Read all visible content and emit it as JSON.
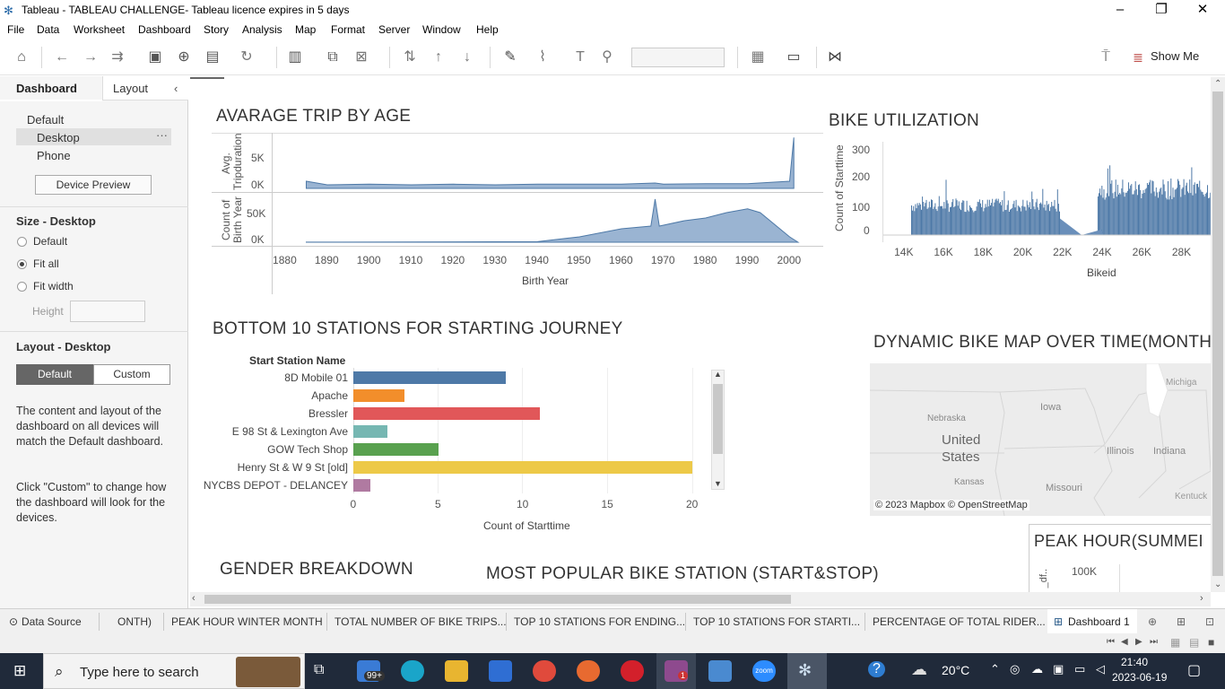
{
  "window": {
    "title": "Tableau - TABLEAU CHALLENGE- Tableau licence expires in 5 days"
  },
  "menu": [
    "File",
    "Data",
    "Worksheet",
    "Dashboard",
    "Story",
    "Analysis",
    "Map",
    "Format",
    "Server",
    "Window",
    "Help"
  ],
  "toolbar": {
    "show_me": "Show Me"
  },
  "left_pane": {
    "tabs": [
      "Dashboard",
      "Layout"
    ],
    "devices": [
      "Default",
      "Desktop",
      "Phone"
    ],
    "device_preview": "Device Preview",
    "size_header": "Size - Desktop",
    "size_options": [
      "Default",
      "Fit all",
      "Fit width"
    ],
    "size_selected": "Fit all",
    "height_label": "Height",
    "layout_header": "Layout - Desktop",
    "layout_buttons": [
      "Default",
      "Custom"
    ],
    "desc1": "The content and layout of the dashboard on all devices will match the Default dashboard.",
    "desc2": "Click \"Custom\" to change how the dashboard will look for the devices."
  },
  "dashboard": {
    "trip_by_age": {
      "title": "AVARAGE TRIP BY AGE",
      "y1_label": "Avg. Tripduration",
      "y1_ticks": [
        "5K",
        "0K"
      ],
      "y2_label": "Count of Birth Year",
      "y2_ticks": [
        "50K",
        "0K"
      ],
      "x_ticks": [
        "1880",
        "1890",
        "1900",
        "1910",
        "1920",
        "1930",
        "1940",
        "1950",
        "1960",
        "1970",
        "1980",
        "1990",
        "2000"
      ],
      "x_label": "Birth Year"
    },
    "bike_utilization": {
      "title": "BIKE UTILIZATION",
      "y_label": "Count of Starttime",
      "y_ticks": [
        "300",
        "200",
        "100",
        "0"
      ],
      "x_ticks": [
        "14K",
        "16K",
        "18K",
        "20K",
        "22K",
        "24K",
        "26K",
        "28K"
      ],
      "x_label": "Bikeid"
    },
    "bottom10": {
      "title": "BOTTOM 10 STATIONS FOR STARTING JOURNEY",
      "header": "Start Station Name",
      "x_ticks": [
        "0",
        "5",
        "10",
        "15",
        "20"
      ],
      "x_label": "Count of Starttime"
    },
    "map": {
      "title": "DYNAMIC BIKE MAP OVER TIME(MONTH",
      "labels": [
        "Michiga",
        "Nebraska",
        "Iowa",
        "United",
        "States",
        "Illinois",
        "Indiana",
        "Kansas",
        "Missouri",
        "Kentuck"
      ],
      "credit": "© 2023 Mapbox © OpenStreetMap"
    },
    "peak_hour": {
      "title": "PEAK HOUR(SUMMEI",
      "tick": "100K",
      "y_label": "_df.."
    },
    "gender": {
      "title": "GENDER BREAKDOWN"
    },
    "popular": {
      "title": "MOST POPULAR BIKE STATION (START&STOP)"
    }
  },
  "chart_data": [
    {
      "type": "area",
      "title": "AVARAGE TRIP BY AGE",
      "xlabel": "Birth Year",
      "series": [
        {
          "name": "Avg. Tripduration",
          "x": [
            1885,
            1890,
            1900,
            1910,
            1920,
            1930,
            1940,
            1950,
            1960,
            1968,
            1970,
            1980,
            1990,
            2000,
            2001
          ],
          "values": [
            1200,
            600,
            700,
            600,
            700,
            600,
            700,
            700,
            700,
            900,
            700,
            800,
            800,
            1200,
            8500
          ]
        },
        {
          "name": "Count of Birth Year",
          "x": [
            1885,
            1940,
            1950,
            1960,
            1967,
            1968,
            1969,
            1975,
            1980,
            1985,
            1990,
            1993,
            2000,
            2002
          ],
          "values": [
            100,
            1000,
            10000,
            25000,
            30000,
            80000,
            30000,
            40000,
            45000,
            55000,
            62000,
            55000,
            10000,
            0
          ]
        }
      ]
    },
    {
      "type": "bar",
      "title": "BIKE UTILIZATION",
      "xlabel": "Bikeid",
      "ylabel": "Count of Starttime",
      "xlim": [
        13000,
        29500
      ],
      "ylim": [
        0,
        330
      ],
      "segments": [
        {
          "from": 14400,
          "to": 21900,
          "typical": 110,
          "max": 190
        },
        {
          "from": 23800,
          "to": 29500,
          "typical": 170,
          "max": 240
        }
      ],
      "fill_between": [
        [
          21900,
          23000
        ],
        [
          23000,
          24000
        ]
      ]
    },
    {
      "type": "bar",
      "title": "BOTTOM 10 STATIONS FOR STARTING JOURNEY",
      "xlabel": "Count of Starttime",
      "xlim": [
        0,
        21
      ],
      "categories": [
        "8D Mobile 01",
        "Apache",
        "Bressler",
        "E 98 St & Lexington Ave",
        "GOW Tech Shop",
        "Henry St & W 9 St [old]",
        "NYCBS DEPOT - DELANCEY"
      ],
      "values": [
        9,
        3,
        11,
        2,
        5,
        20,
        1
      ],
      "colors": [
        "#4e79a7",
        "#f28e2b",
        "#e15759",
        "#76b7b2",
        "#59a14f",
        "#edc948",
        "#b07aa1"
      ]
    }
  ],
  "sheet_tabs": [
    "Data Source",
    "ONTH)",
    "PEAK HOUR WINTER MONTH",
    "TOTAL NUMBER OF BIKE TRIPS...",
    "TOP 10 STATIONS FOR ENDING...",
    "TOP 10 STATIONS FOR STARTI...",
    "PERCENTAGE OF TOTAL RIDER...",
    "Dashboard 1"
  ],
  "taskbar": {
    "search_placeholder": "Type here to search",
    "badge": "99+",
    "notification": "1",
    "zoom_label": "zoom",
    "temperature": "20°C",
    "time": "21:40",
    "date": "2023-06-19"
  }
}
